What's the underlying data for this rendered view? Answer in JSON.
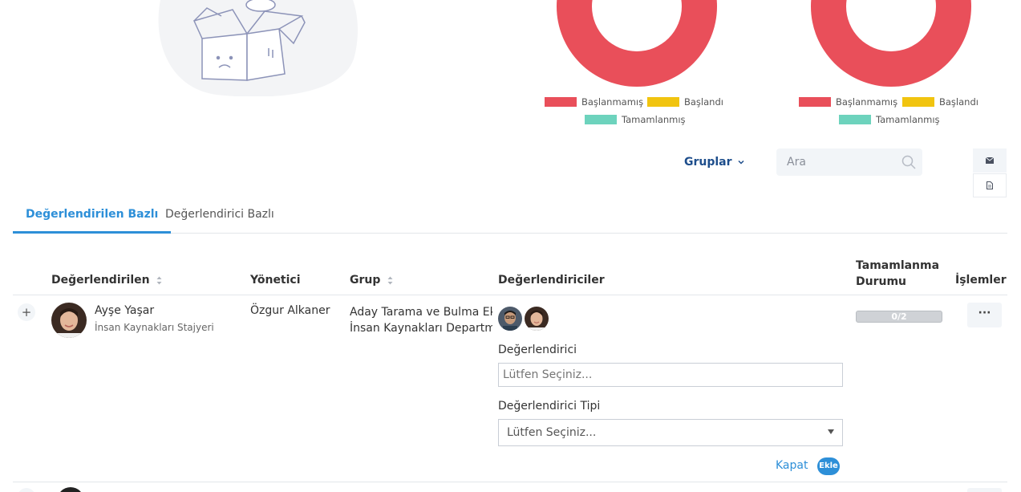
{
  "charts": {
    "legend": {
      "not_started": "Başlanmamış",
      "started": "Başlandı",
      "completed": "Tamamlanmış"
    },
    "colors": {
      "not_started": "#e94f5a",
      "started": "#f1c40f",
      "completed": "#6dd3bd"
    }
  },
  "toolbar": {
    "groups_label": "Gruplar",
    "search_placeholder": "Ara"
  },
  "tabs": [
    {
      "label": "Değerlendirilen Bazlı",
      "active": true
    },
    {
      "label": "Değerlendirici Bazlı",
      "active": false
    }
  ],
  "table": {
    "headers": {
      "evaluated": "Değerlendirilen",
      "manager": "Yönetici",
      "group": "Grup",
      "evaluators": "Değerlendiriciler",
      "completion_line1": "Tamamlanma",
      "completion_line2": "Durumu",
      "actions": "İşlemler"
    },
    "rows": [
      {
        "expand": "+",
        "name": "Ayşe Yaşar",
        "role": "İnsan Kaynakları Stajyeri",
        "manager": "Özgur Alkaner",
        "group_line1": "Aday Tarama ve Bulma Ekibi",
        "group_line2": "İnsan Kaynakları Departmanı",
        "progress": "0/2",
        "more": "···"
      }
    ]
  },
  "form": {
    "evaluator_label": "Değerlendirici",
    "evaluator_placeholder": "Lütfen Seçiniz...",
    "evaluator_type_label": "Değerlendirici Tipi",
    "evaluator_type_value": "Lütfen Seçiniz...",
    "close_label": "Kapat",
    "add_label": "Ekle"
  }
}
